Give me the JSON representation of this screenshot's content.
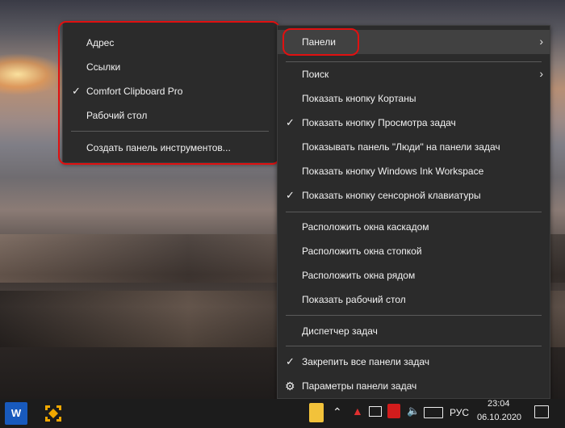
{
  "submenu": {
    "items": [
      {
        "label": "Адрес",
        "checked": false
      },
      {
        "label": "Ссылки",
        "checked": false
      },
      {
        "label": "Comfort Clipboard Pro",
        "checked": true
      },
      {
        "label": "Рабочий стол",
        "checked": false
      }
    ],
    "create_toolbar_label": "Создать панель инструментов..."
  },
  "context_menu": {
    "panels_label": "Панели",
    "search_label": "Поиск",
    "show_cortana_label": "Показать кнопку Кортаны",
    "show_task_view_label": "Показать кнопку Просмотра задач",
    "show_people_label": "Показывать панель \"Люди\" на панели задач",
    "show_ink_label": "Показать кнопку Windows Ink Workspace",
    "show_keyboard_label": "Показать кнопку сенсорной клавиатуры",
    "cascade_label": "Расположить окна каскадом",
    "stack_label": "Расположить окна стопкой",
    "side_by_side_label": "Расположить окна рядом",
    "show_desktop_label": "Показать рабочий стол",
    "task_manager_label": "Диспетчер задач",
    "lock_taskbars_label": "Закрепить все панели задач",
    "taskbar_settings_label": "Параметры панели задач"
  },
  "taskbar": {
    "word_icon_letter": "W",
    "language": "РУС",
    "time": "23:04",
    "date": "06.10.2020"
  },
  "colors": {
    "menu_bg": "#2b2b2b",
    "hover_bg": "#414141",
    "highlight_ring": "#e01010",
    "taskbar_bg": "#1c1c1c"
  }
}
